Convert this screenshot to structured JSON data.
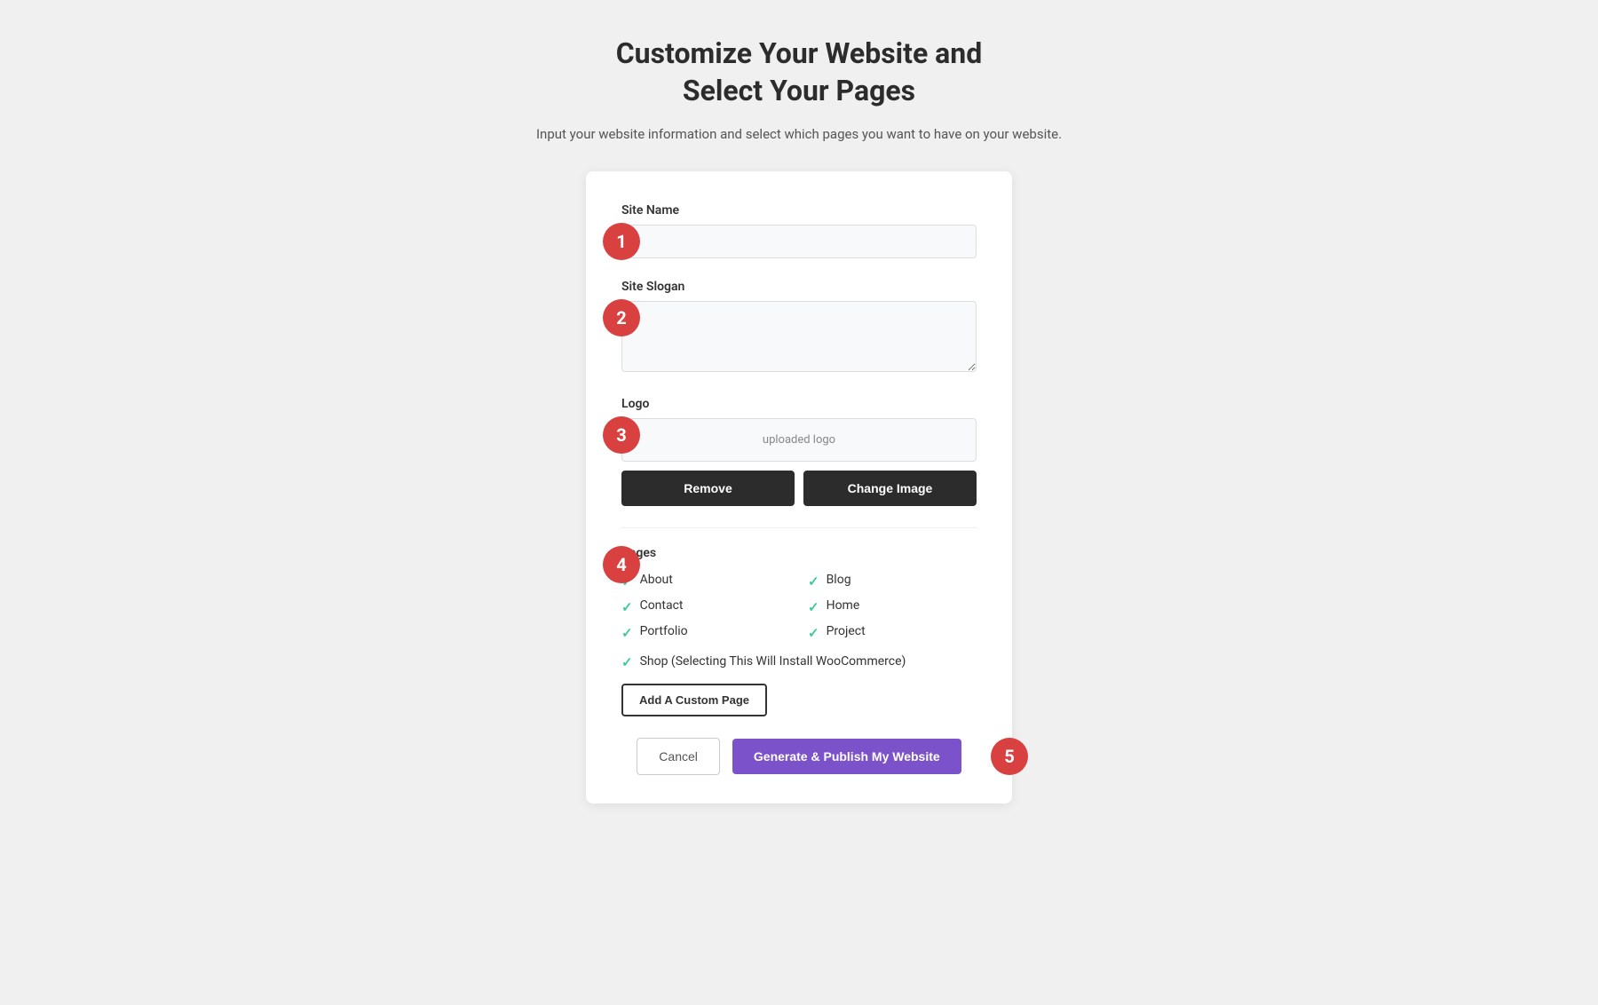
{
  "header": {
    "title_line1": "Customize Your Website and",
    "title_line2": "Select Your Pages",
    "subtitle": "Input your website information and select which pages you want to have on your website."
  },
  "steps": {
    "step1": "1",
    "step2": "2",
    "step3": "3",
    "step4": "4",
    "step5": "5"
  },
  "form": {
    "site_name_label": "Site Name",
    "site_name_placeholder": "",
    "site_slogan_label": "Site Slogan",
    "site_slogan_placeholder": "",
    "logo_label": "Logo",
    "logo_preview_text": "uploaded logo",
    "remove_button": "Remove",
    "change_image_button": "Change Image",
    "pages_label": "Pages",
    "pages": [
      {
        "name": "About",
        "checked": true
      },
      {
        "name": "Blog",
        "checked": true
      },
      {
        "name": "Contact",
        "checked": true
      },
      {
        "name": "Home",
        "checked": true
      },
      {
        "name": "Portfolio",
        "checked": true
      },
      {
        "name": "Project",
        "checked": true
      }
    ],
    "shop_page": {
      "name": "Shop (Selecting This Will Install WooCommerce)",
      "checked": true
    },
    "add_custom_page_button": "Add A Custom Page",
    "cancel_button": "Cancel",
    "publish_button": "Generate & Publish My Website"
  }
}
